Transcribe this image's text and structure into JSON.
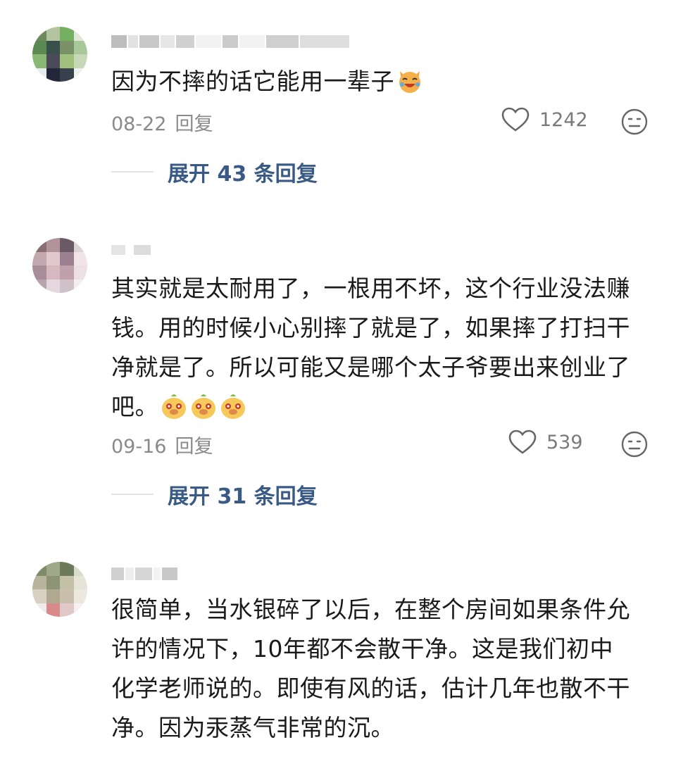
{
  "comments": [
    {
      "username": "",
      "text": "因为不摔的话它能用一辈子",
      "emojis": [
        "laughing-cat-emoji"
      ],
      "date": "08-22",
      "reply_label": "回复",
      "likes": "1242",
      "expand_label": "展开 43 条回复"
    },
    {
      "username": "",
      "text": "其实就是太耐用了，一根用不坏，这个行业没法赚钱。用的时候小心别摔了就是了，如果摔了打扫干净就是了。所以可能又是哪个太子爷要出来创业了吧。",
      "emojis": [
        "dog-emoji",
        "dog-emoji",
        "dog-emoji"
      ],
      "date": "09-16",
      "reply_label": "回复",
      "likes": "539",
      "expand_label": "展开 31 条回复"
    },
    {
      "username": "",
      "text": "很简单，当水银碎了以后，在整个房间如果条件允许的情况下，10年都不会散干净。这是我们初中化学老师说的。即使有风的话，估计几年也散不干净。因为汞蒸气非常的沉。",
      "emojis": []
    }
  ],
  "icons": {
    "like": "heart-icon",
    "dislike": "meh-face-icon"
  },
  "colors": {
    "link": "#3a5a86",
    "meta": "#8a8a8a",
    "text": "#1a1a1a"
  }
}
